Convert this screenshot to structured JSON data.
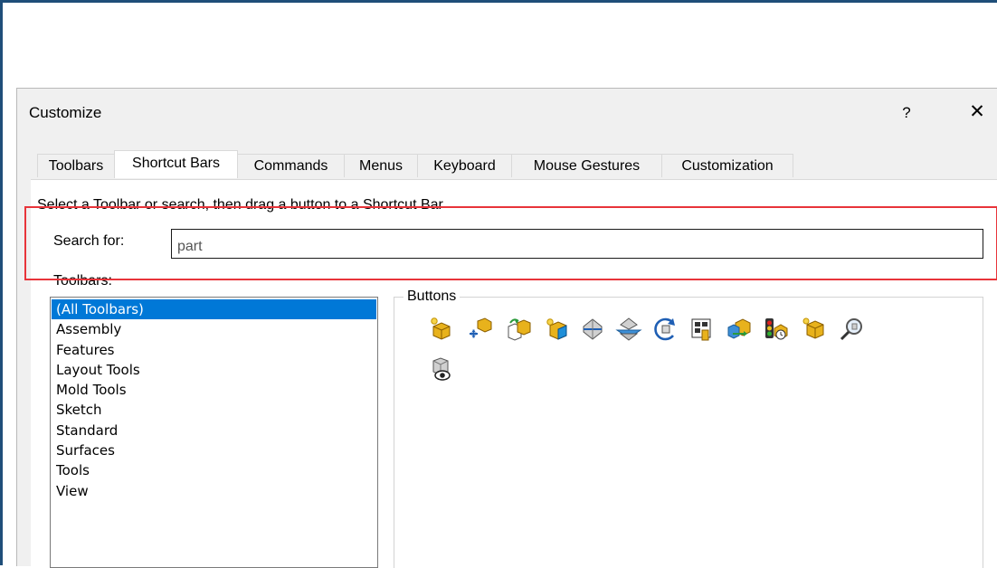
{
  "dialog": {
    "title": "Customize",
    "help_label": "?",
    "close_label": "✕"
  },
  "tabs": [
    {
      "label": "Toolbars"
    },
    {
      "label": "Shortcut Bars"
    },
    {
      "label": "Commands"
    },
    {
      "label": "Menus"
    },
    {
      "label": "Keyboard"
    },
    {
      "label": "Mouse Gestures"
    },
    {
      "label": "Customization"
    }
  ],
  "panel": {
    "instruction": "Select a Toolbar or search, then drag a button to a Shortcut Bar",
    "search_label": "Search for:",
    "search_value": "part",
    "toolbars_label": "Toolbars:",
    "buttons_label": "Buttons"
  },
  "toolbars": [
    {
      "label": "(All Toolbars)"
    },
    {
      "label": "Assembly"
    },
    {
      "label": "Features"
    },
    {
      "label": "Layout Tools"
    },
    {
      "label": "Mold Tools"
    },
    {
      "label": "Sketch"
    },
    {
      "label": "Standard"
    },
    {
      "label": "Surfaces"
    },
    {
      "label": "Tools"
    },
    {
      "label": "View"
    }
  ],
  "buttons": [
    {
      "icon": "insert-part-icon"
    },
    {
      "icon": "move-component-icon"
    },
    {
      "icon": "replace-part-icon"
    },
    {
      "icon": "new-part-icon"
    },
    {
      "icon": "split-part-icon"
    },
    {
      "icon": "mirror-part-icon"
    },
    {
      "icon": "rotate-part-icon"
    },
    {
      "icon": "part-reviewer-icon"
    },
    {
      "icon": "save-bodies-icon"
    },
    {
      "icon": "part-performance-icon"
    },
    {
      "icon": "edit-part-icon"
    },
    {
      "icon": "find-part-icon"
    },
    {
      "icon": "view-part-icon"
    }
  ],
  "colors": {
    "highlight": "#e8343a",
    "selection": "#0078d7",
    "frame": "#1f4e79"
  }
}
